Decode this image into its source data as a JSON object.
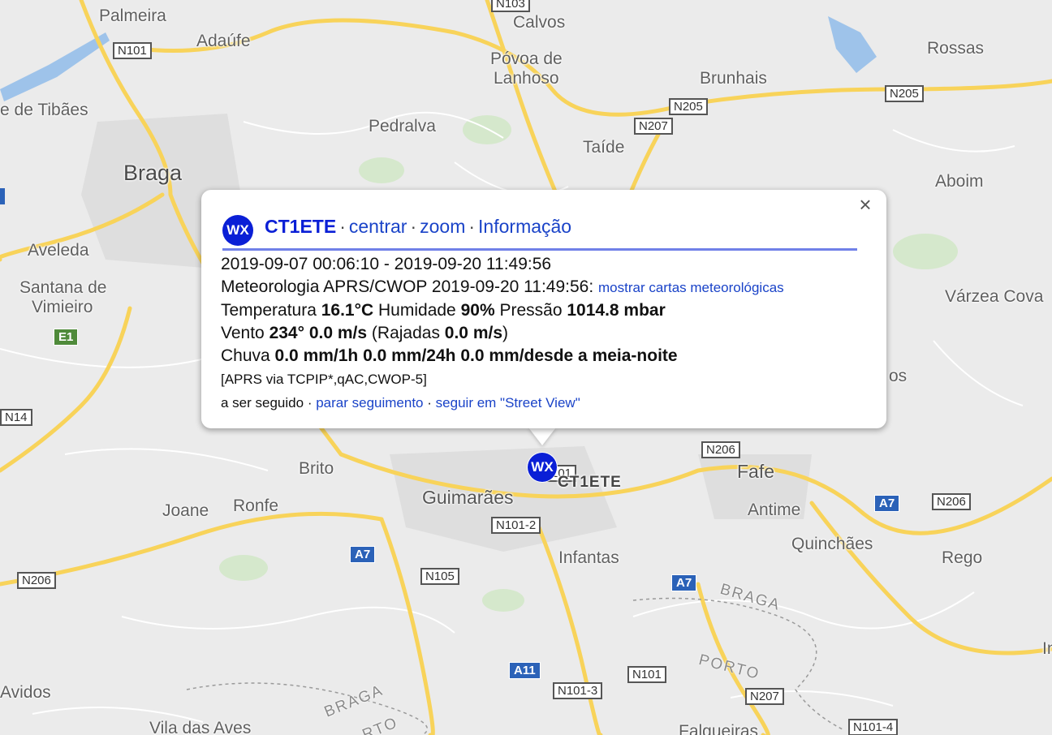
{
  "map": {
    "places": [
      {
        "name": "Palmeira"
      },
      {
        "name": "Adaúfe"
      },
      {
        "name": "Calvos"
      },
      {
        "name": "Póvoa de"
      },
      {
        "name": "Lanhoso"
      },
      {
        "name": "Rossas"
      },
      {
        "name": "Brunhais"
      },
      {
        "name": "e de Tibães"
      },
      {
        "name": "Pedralva"
      },
      {
        "name": "Taíde"
      },
      {
        "name": "Braga"
      },
      {
        "name": "Aboim"
      },
      {
        "name": "Aveleda"
      },
      {
        "name": "Santana de"
      },
      {
        "name": "Vimieiro"
      },
      {
        "name": "Várzea Cova"
      },
      {
        "name": "os"
      },
      {
        "name": "Brito"
      },
      {
        "name": "Guimarães"
      },
      {
        "name": "Fafe"
      },
      {
        "name": "Joane"
      },
      {
        "name": "Ronfe"
      },
      {
        "name": "Antime"
      },
      {
        "name": "Quinchães"
      },
      {
        "name": "Infantas"
      },
      {
        "name": "Rego"
      },
      {
        "name": "Avidos"
      },
      {
        "name": "Vila das Aves"
      },
      {
        "name": "Falgueiras"
      },
      {
        "name": "In"
      }
    ],
    "regions": [
      {
        "name": "BRAGA"
      },
      {
        "name": "PORTO"
      },
      {
        "name": "BRAGA"
      },
      {
        "name": "RTO"
      }
    ],
    "roads": [
      {
        "label": "N101"
      },
      {
        "label": "N205"
      },
      {
        "label": "N205"
      },
      {
        "label": "N207"
      },
      {
        "label": "E1"
      },
      {
        "label": "N14"
      },
      {
        "label": "N206"
      },
      {
        "label": "N206"
      },
      {
        "label": "A7"
      },
      {
        "label": "N206"
      },
      {
        "label": "A7"
      },
      {
        "label": "N101-2"
      },
      {
        "label": "N105"
      },
      {
        "label": "A7"
      },
      {
        "label": "A11"
      },
      {
        "label": "N101"
      },
      {
        "label": "N101-3"
      },
      {
        "label": "N207"
      },
      {
        "label": "N101-4"
      },
      {
        "label": "N103"
      },
      {
        "label": "101"
      }
    ],
    "colors": {
      "land": "#ebebeb",
      "road_major": "#f8d35a",
      "road_minor": "#ffffff",
      "urban": "#dedede",
      "water": "#9ec3ea",
      "park": "#cfe6c4"
    }
  },
  "marker": {
    "icon": "WX",
    "label": "CT1ETE",
    "color": "#0a1fd6"
  },
  "infowindow": {
    "wx_icon": "WX",
    "callsign": "CT1ETE",
    "sep": "·",
    "links": [
      "centrar",
      "zoom",
      "Informação"
    ],
    "close_icon": "×",
    "range": "2019-09-07 00:06:10 - 2019-09-20 11:49:56",
    "met_prefix": "Meteorologia APRS/CWOP 2019-09-20 11:49:56:",
    "met_link": "mostrar cartas meteorológicas",
    "temp_label": "Temperatura",
    "temp_value": "16.1°C",
    "hum_label": "Humidade",
    "hum_value": "90%",
    "press_label": "Pressão",
    "press_value": "1014.8 mbar",
    "wind_label": "Vento",
    "wind_value": "234° 0.0 m/s",
    "gust_open": "(Rajadas",
    "gust_value": "0.0 m/s",
    "gust_close": ")",
    "rain_label": "Chuva",
    "rain_value": "0.0 mm/1h 0.0 mm/24h 0.0 mm/desde a meia-noite",
    "path": "[APRS via TCPIP*,qAC,CWOP-5]",
    "tracking": "a ser seguido",
    "stop_link": "parar seguimento",
    "sv_link": "seguir em \"Street View\""
  }
}
